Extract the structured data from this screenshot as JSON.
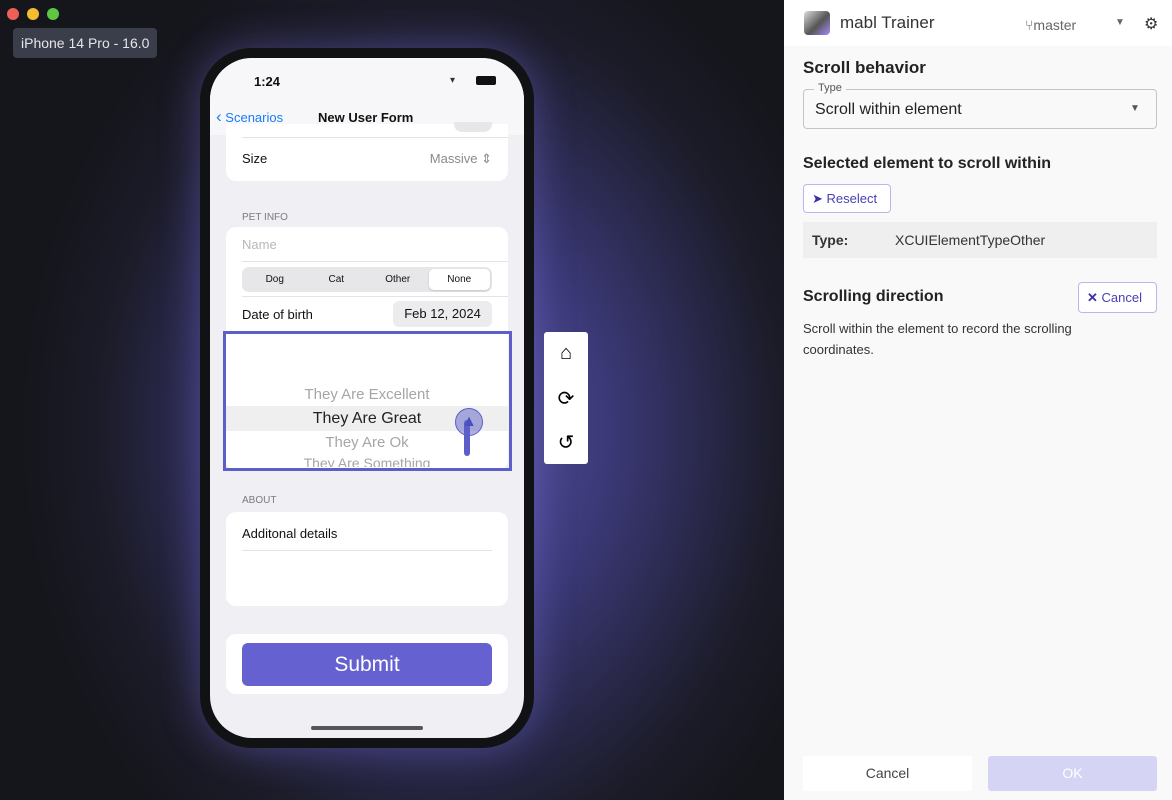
{
  "window": {
    "traffic_lights": [
      "#ee5f57",
      "#f4bd2f",
      "#5ec640"
    ]
  },
  "simulator": {
    "device_label": "iPhone 14 Pro - 16.0"
  },
  "phone": {
    "status": {
      "time": "1:24"
    },
    "nav": {
      "back_label": "Scenarios",
      "title": "New User Form"
    },
    "size_row": {
      "label": "Size",
      "value": "Massive"
    },
    "pet_info": {
      "header": "PET INFO",
      "name_placeholder": "Name",
      "segments": [
        "Dog",
        "Cat",
        "Other",
        "None"
      ],
      "selected_segment": "None",
      "dob_label": "Date of birth",
      "dob_value": "Feb 12, 2024"
    },
    "picker": {
      "items": [
        "They Are Excellent",
        "They Are Great",
        "They Are Ok",
        "They Are Something"
      ],
      "selected": "They Are Great"
    },
    "about": {
      "header": "ABOUT",
      "details_label": "Additonal details"
    },
    "submit_label": "Submit",
    "accent": "#6661d0"
  },
  "toolbar": {
    "icons": [
      "home-icon",
      "rotate-icon",
      "reset-icon"
    ]
  },
  "trainer": {
    "app_title": "mabl Trainer",
    "branch": "master",
    "section_title": "Scroll behavior",
    "type_field": {
      "label": "Type",
      "value": "Scroll within element"
    },
    "selected_title": "Selected element to scroll within",
    "reselect_label": "Reselect",
    "element_type": {
      "key": "Type:",
      "value": "XCUIElementTypeOther"
    },
    "direction_title": "Scrolling direction",
    "direction_cancel": "Cancel",
    "direction_help": "Scroll within the element to record the scrolling coordinates.",
    "footer": {
      "cancel": "Cancel",
      "ok": "OK"
    }
  }
}
